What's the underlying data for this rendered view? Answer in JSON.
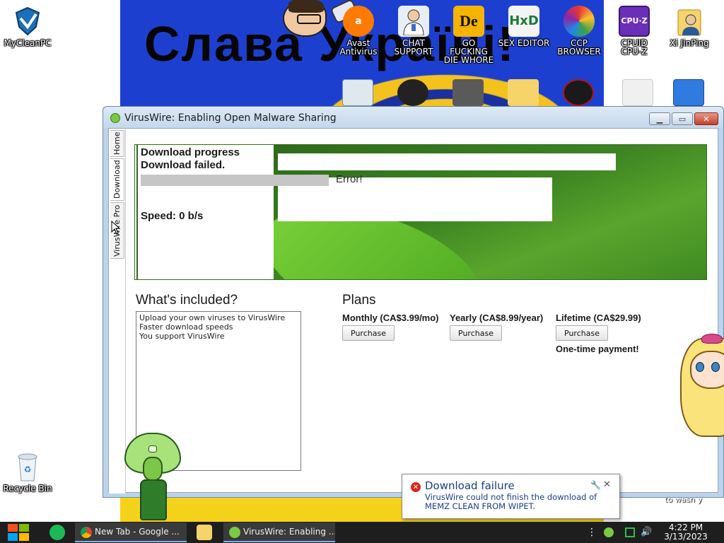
{
  "desktop": {
    "wallpaper_text": "Слава Україні!",
    "wallpaper_caption": "to wash y",
    "icons": [
      {
        "id": "mycleanpc",
        "label": "MyCleanPC"
      },
      {
        "id": "avast",
        "label": "Avast\nAntivirus"
      },
      {
        "id": "chat",
        "label": "CHAT\nSUPPORT"
      },
      {
        "id": "gofuck",
        "label": "GO FUCKING\nDIE WHORE"
      },
      {
        "id": "sexeditor",
        "label": "SEX EDITOR"
      },
      {
        "id": "ccp",
        "label": "CCP\nBROWSER"
      },
      {
        "id": "cpuz",
        "label": "CPUID\nCPU-Z"
      },
      {
        "id": "xijinping",
        "label": "Xi JinPing"
      },
      {
        "id": "recycle",
        "label": "Recycle Bin"
      }
    ]
  },
  "window": {
    "title": "VirusWire: Enabling Open Malware Sharing",
    "tabs": [
      "Home",
      "Download",
      "VirusWire Pro"
    ],
    "active_tab": "Download",
    "download": {
      "heading": "Download progress",
      "status": "Download failed.",
      "error": "Error!",
      "speed": "Speed: 0 b/s",
      "progress_fraction": 0
    },
    "included": {
      "heading": "What's included?",
      "items": [
        "Upload your own viruses to VirusWire",
        "Faster download speeds",
        "You support VirusWire"
      ]
    },
    "plans": {
      "heading": "Plans",
      "items": [
        {
          "name": "Monthly (CA$3.99/mo)",
          "button": "Purchase"
        },
        {
          "name": "Yearly (CA$8.99/year)",
          "button": "Purchase"
        },
        {
          "name": "Lifetime (CA$29.99)",
          "button": "Purchase"
        }
      ],
      "note": "One-time payment!"
    }
  },
  "notification": {
    "title": "Download failure",
    "body": "VirusWire could not finish the download of MEMZ CLEAN FROM WIPET."
  },
  "taskbar": {
    "tasks": [
      {
        "label": "New Tab - Google ..."
      },
      {
        "label": "VirusWire: Enabling ..."
      }
    ],
    "time": "4:22 PM",
    "date": "3/13/2023"
  },
  "colors": {
    "accent_green": "#3c8422",
    "progress_green": "#06b025",
    "notification_text": "#1d3d8a",
    "error_red": "#d9261c"
  }
}
